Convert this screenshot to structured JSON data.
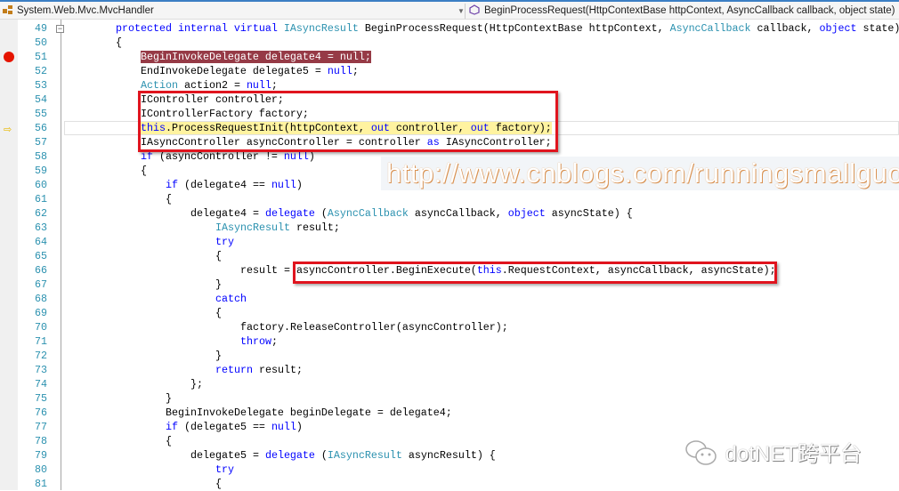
{
  "navbar": {
    "class_selector": {
      "value": "System.Web.Mvc.MvcHandler",
      "icon": "class-icon"
    },
    "member_selector": {
      "value": "BeginProcessRequest(HttpContextBase httpContext, AsyncCallback callback, object state)",
      "icon": "method-icon"
    }
  },
  "editor": {
    "breakpoint_line": 51,
    "current_line": 56,
    "lines": [
      {
        "num": "49",
        "indent": 8,
        "tokens": [
          [
            "k",
            "protected internal virtual "
          ],
          [
            "t",
            "IAsyncResult"
          ],
          [
            "",
            ""
          ],
          [
            "",
            " BeginProcessRequest(HttpContextBase httpContext, "
          ],
          [
            "t",
            "AsyncCallback"
          ],
          [
            "",
            " callback, "
          ],
          [
            "k",
            "object"
          ],
          [
            "",
            " state)"
          ]
        ]
      },
      {
        "num": "50",
        "indent": 8,
        "tokens": [
          [
            "",
            "{"
          ]
        ]
      },
      {
        "num": "51",
        "indent": 12,
        "tokens": [
          [
            "bp",
            "BeginInvokeDelegate delegate4 = null;"
          ]
        ]
      },
      {
        "num": "52",
        "indent": 12,
        "tokens": [
          [
            "",
            "EndInvokeDelegate delegate5 = "
          ],
          [
            "k",
            "null"
          ],
          [
            "",
            ";"
          ]
        ]
      },
      {
        "num": "53",
        "indent": 12,
        "tokens": [
          [
            "t",
            "Action"
          ],
          [
            "",
            " action2 = "
          ],
          [
            "k",
            "null"
          ],
          [
            "",
            ";"
          ]
        ]
      },
      {
        "num": "54",
        "indent": 12,
        "tokens": [
          [
            "",
            "IController controller;"
          ]
        ]
      },
      {
        "num": "55",
        "indent": 12,
        "tokens": [
          [
            "",
            "IControllerFactory factory;"
          ]
        ]
      },
      {
        "num": "56",
        "indent": 12,
        "tokens": [
          [
            "k cur",
            "this"
          ],
          [
            "cur",
            ".ProcessRequestInit(httpContext, "
          ],
          [
            "k cur",
            "out"
          ],
          [
            "cur",
            " controller, "
          ],
          [
            "k cur",
            "out"
          ],
          [
            "cur",
            " factory);"
          ]
        ]
      },
      {
        "num": "57",
        "indent": 12,
        "tokens": [
          [
            "",
            "IAsyncController asyncController = controller "
          ],
          [
            "k",
            "as"
          ],
          [
            "",
            " IAsyncController;"
          ]
        ]
      },
      {
        "num": "58",
        "indent": 12,
        "tokens": [
          [
            "k",
            "if"
          ],
          [
            "",
            " (asyncController != "
          ],
          [
            "k",
            "null"
          ],
          [
            "",
            ")"
          ]
        ]
      },
      {
        "num": "59",
        "indent": 12,
        "tokens": [
          [
            "",
            "{"
          ]
        ]
      },
      {
        "num": "60",
        "indent": 16,
        "tokens": [
          [
            "k",
            "if"
          ],
          [
            "",
            " (delegate4 == "
          ],
          [
            "k",
            "null"
          ],
          [
            "",
            ")"
          ]
        ]
      },
      {
        "num": "61",
        "indent": 16,
        "tokens": [
          [
            "",
            "{"
          ]
        ]
      },
      {
        "num": "62",
        "indent": 20,
        "tokens": [
          [
            "",
            "delegate4 = "
          ],
          [
            "k",
            "delegate"
          ],
          [
            "",
            " ("
          ],
          [
            "t",
            "AsyncCallback"
          ],
          [
            "",
            " asyncCallback, "
          ],
          [
            "k",
            "object"
          ],
          [
            "",
            " asyncState) {"
          ]
        ]
      },
      {
        "num": "63",
        "indent": 24,
        "tokens": [
          [
            "t",
            "IAsyncResult"
          ],
          [
            "",
            " result;"
          ]
        ]
      },
      {
        "num": "64",
        "indent": 24,
        "tokens": [
          [
            "k",
            "try"
          ]
        ]
      },
      {
        "num": "65",
        "indent": 24,
        "tokens": [
          [
            "",
            "{"
          ]
        ]
      },
      {
        "num": "66",
        "indent": 28,
        "tokens": [
          [
            "",
            "result = asyncController.BeginExecute("
          ],
          [
            "k",
            "this"
          ],
          [
            "",
            ".RequestContext, asyncCallback, asyncState);"
          ]
        ]
      },
      {
        "num": "67",
        "indent": 24,
        "tokens": [
          [
            "",
            "}"
          ]
        ]
      },
      {
        "num": "68",
        "indent": 24,
        "tokens": [
          [
            "k",
            "catch"
          ]
        ]
      },
      {
        "num": "69",
        "indent": 24,
        "tokens": [
          [
            "",
            "{"
          ]
        ]
      },
      {
        "num": "70",
        "indent": 28,
        "tokens": [
          [
            "",
            "factory.ReleaseController(asyncController);"
          ]
        ]
      },
      {
        "num": "71",
        "indent": 28,
        "tokens": [
          [
            "k",
            "throw"
          ],
          [
            "",
            ";"
          ]
        ]
      },
      {
        "num": "72",
        "indent": 24,
        "tokens": [
          [
            "",
            "}"
          ]
        ]
      },
      {
        "num": "73",
        "indent": 24,
        "tokens": [
          [
            "k",
            "return"
          ],
          [
            "",
            " result;"
          ]
        ]
      },
      {
        "num": "74",
        "indent": 20,
        "tokens": [
          [
            "",
            "};"
          ]
        ]
      },
      {
        "num": "75",
        "indent": 16,
        "tokens": [
          [
            "",
            "}"
          ]
        ]
      },
      {
        "num": "76",
        "indent": 16,
        "tokens": [
          [
            "",
            "BeginInvokeDelegate beginDelegate = delegate4;"
          ]
        ]
      },
      {
        "num": "77",
        "indent": 16,
        "tokens": [
          [
            "k",
            "if"
          ],
          [
            "",
            " (delegate5 == "
          ],
          [
            "k",
            "null"
          ],
          [
            "",
            ")"
          ]
        ]
      },
      {
        "num": "78",
        "indent": 16,
        "tokens": [
          [
            "",
            "{"
          ]
        ]
      },
      {
        "num": "79",
        "indent": 20,
        "tokens": [
          [
            "",
            "delegate5 = "
          ],
          [
            "k",
            "delegate"
          ],
          [
            "",
            " ("
          ],
          [
            "t",
            "IAsyncResult"
          ],
          [
            "",
            " asyncResult) {"
          ]
        ]
      },
      {
        "num": "80",
        "indent": 24,
        "tokens": [
          [
            "k",
            "try"
          ]
        ]
      },
      {
        "num": "81",
        "indent": 24,
        "tokens": [
          [
            "",
            "{"
          ]
        ]
      }
    ]
  },
  "colors": {
    "keyword": "#0000ff",
    "type": "#2b91af",
    "breakpoint": "#963a46",
    "current_line": "#fff3a0",
    "annotation_box": "#e0141e"
  },
  "watermark": {
    "url": "http://www.cnblogs.com/runningsmallguo/"
  },
  "brand": {
    "name": "dotNET跨平台",
    "icon": "wechat-icon"
  }
}
